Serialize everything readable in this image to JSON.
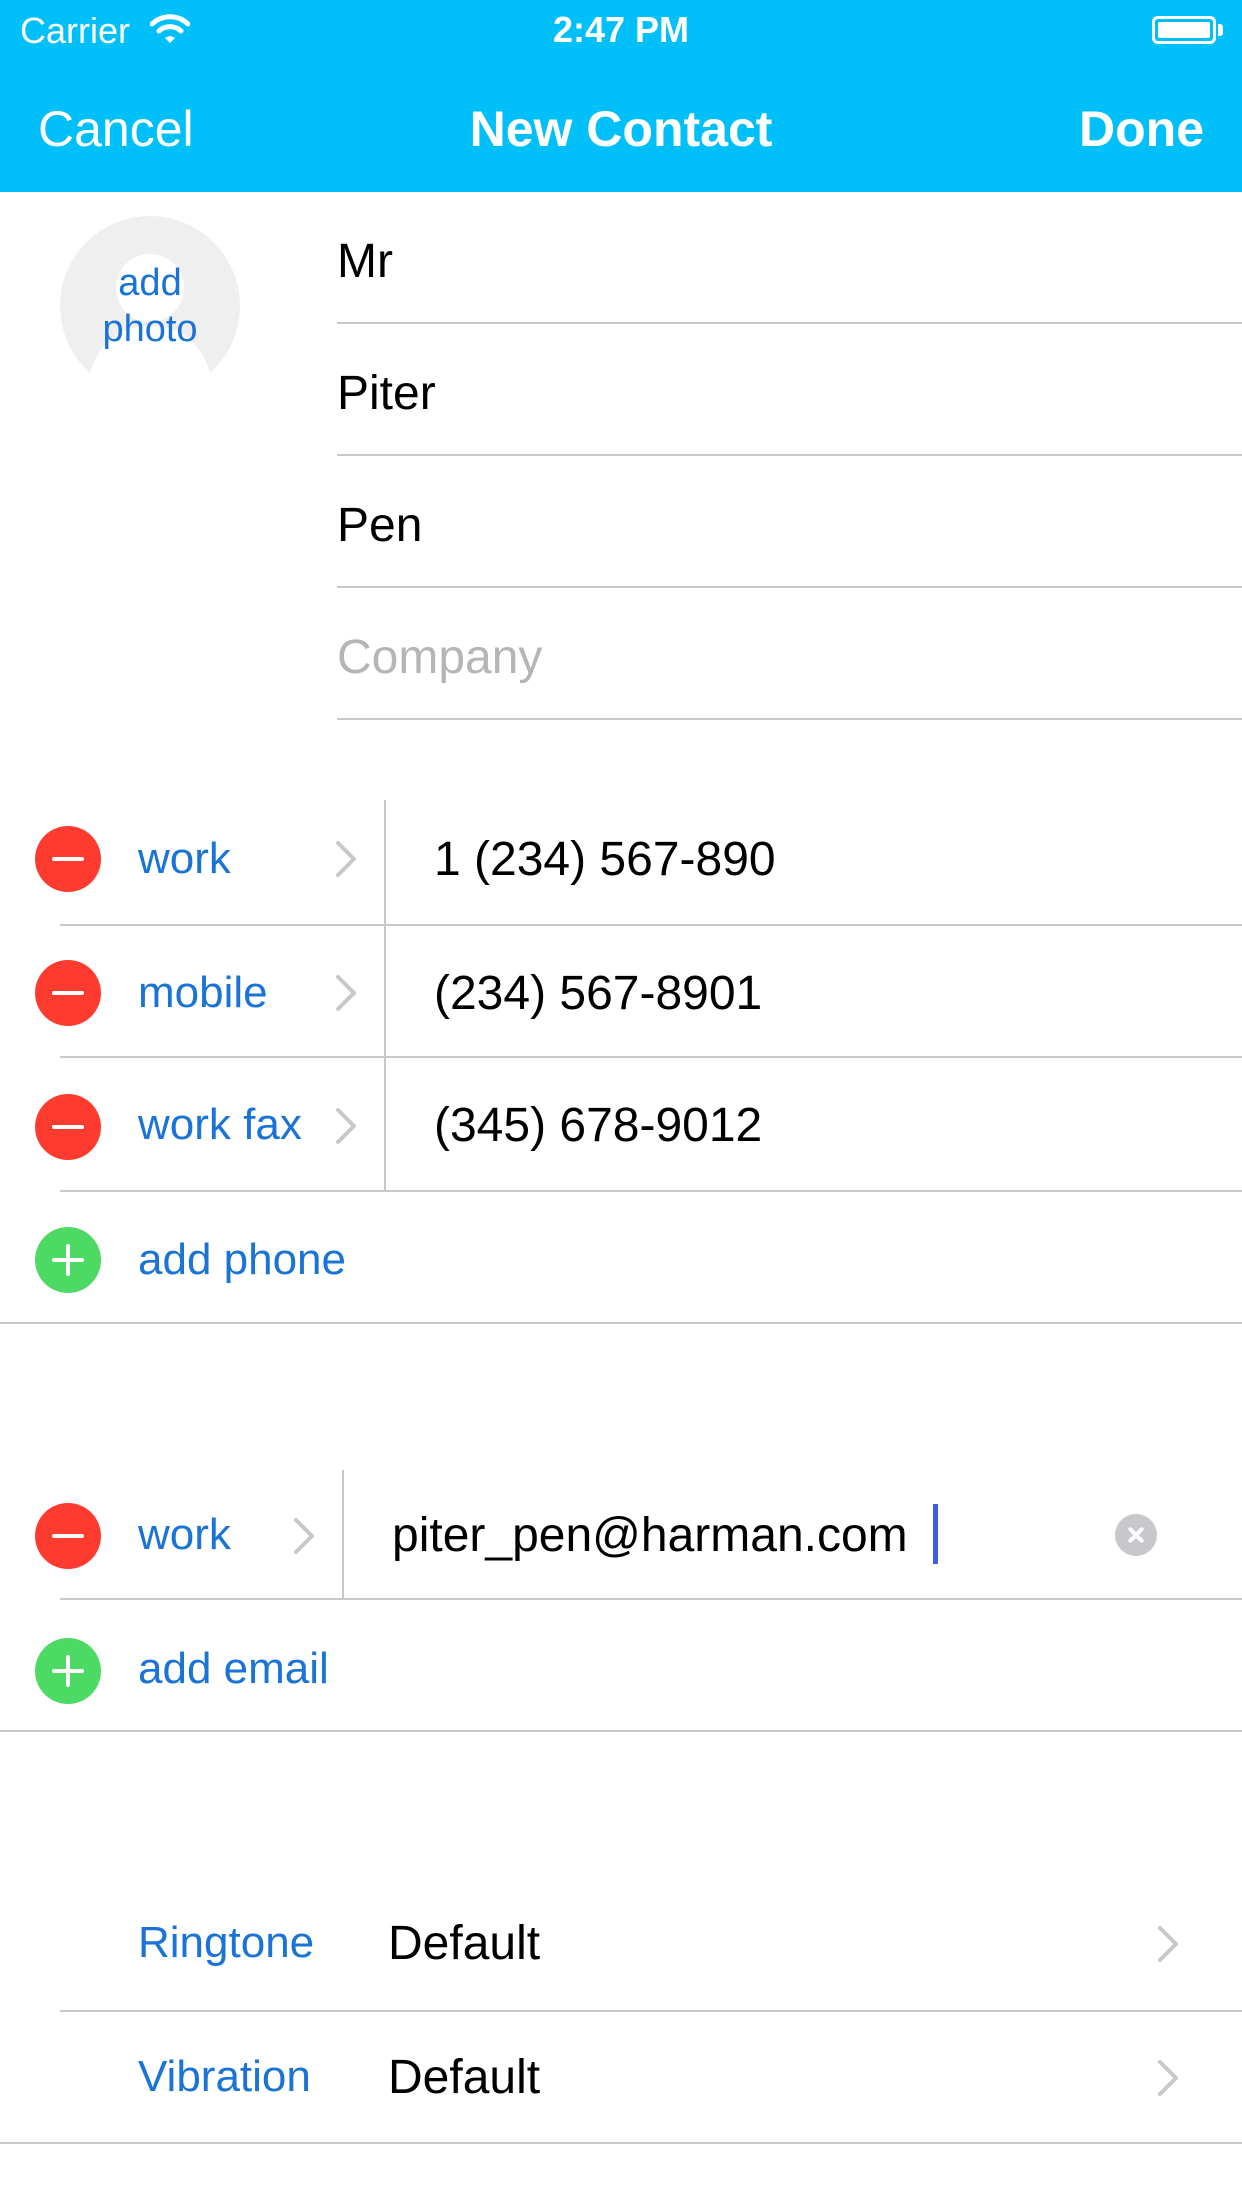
{
  "status_bar": {
    "carrier": "Carrier",
    "time": "2:47 PM"
  },
  "nav": {
    "cancel": "Cancel",
    "title": "New Contact",
    "done": "Done"
  },
  "avatar": {
    "line1": "add",
    "line2": "photo"
  },
  "name_fields": [
    {
      "value": "Mr"
    },
    {
      "value": "Piter"
    },
    {
      "value": "Pen"
    },
    {
      "placeholder": "Company"
    }
  ],
  "phones": [
    {
      "label": "work",
      "value": "1 (234) 567-890"
    },
    {
      "label": "mobile",
      "value": "(234) 567-8901"
    },
    {
      "label": "work fax",
      "value": "(345) 678-9012"
    }
  ],
  "add_phone": "add phone",
  "emails": [
    {
      "label": "work",
      "value": "piter_pen@harman.com"
    }
  ],
  "add_email": "add email",
  "settings": [
    {
      "label": "Ringtone",
      "value": "Default"
    },
    {
      "label": "Vibration",
      "value": "Default"
    }
  ],
  "colors": {
    "accent_bar": "#00bff9",
    "link_blue": "#1a73d6",
    "delete_red": "#ff3b30",
    "add_green": "#4cd964"
  },
  "icons": [
    "wifi-icon",
    "battery-icon",
    "avatar-silhouette-icon",
    "minus-circle-icon",
    "plus-circle-icon",
    "chevron-right-icon",
    "clear-text-icon"
  ]
}
